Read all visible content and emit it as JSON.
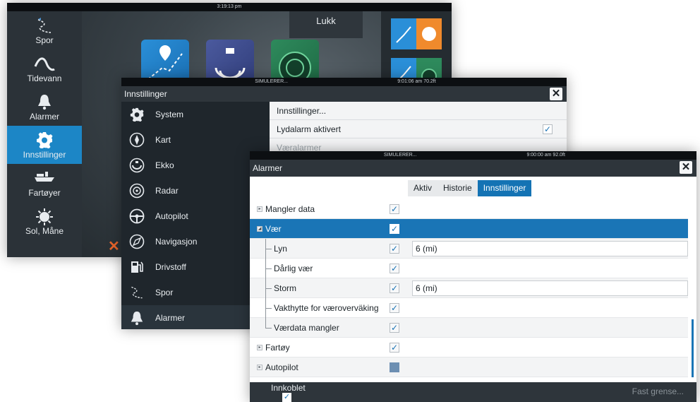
{
  "screen1": {
    "clock": "3:19:13 pm",
    "close_label": "Lukk",
    "sidebar": [
      {
        "label": "Spor",
        "icon": "track-icon"
      },
      {
        "label": "Tidevann",
        "icon": "tide-icon"
      },
      {
        "label": "Alarmer",
        "icon": "bell-icon"
      },
      {
        "label": "Innstillinger",
        "icon": "gear-icon",
        "active": true
      },
      {
        "label": "Fartøyer",
        "icon": "vessel-icon"
      },
      {
        "label": "Sol, Måne",
        "icon": "sun-moon-icon"
      }
    ]
  },
  "screen2": {
    "status_left": "SIMULERER...",
    "status_right": "9:01:06 am  70.2ft",
    "title": "Innstillinger",
    "menu": [
      {
        "label": "System",
        "icon": "gear-icon"
      },
      {
        "label": "Kart",
        "icon": "chart-icon"
      },
      {
        "label": "Ekko",
        "icon": "echo-icon"
      },
      {
        "label": "Radar",
        "icon": "radar-icon"
      },
      {
        "label": "Autopilot",
        "icon": "steering-wheel-icon"
      },
      {
        "label": "Navigasjon",
        "icon": "compass-icon"
      },
      {
        "label": "Drivstoff",
        "icon": "fuel-icon"
      },
      {
        "label": "Spor",
        "icon": "track-icon"
      },
      {
        "label": "Alarmer",
        "icon": "bell-icon",
        "active": true
      }
    ],
    "panel": [
      {
        "label": "Innstillinger..."
      },
      {
        "label": "Lydalarm aktivert",
        "checked": true
      },
      {
        "label": "Væralarmer"
      }
    ]
  },
  "screen3": {
    "status_left": "SIMULERER...",
    "status_right": "9:00:00 am  92.0ft",
    "title": "Alarmer",
    "tabs": [
      {
        "label": "Aktiv",
        "active": false
      },
      {
        "label": "Historie",
        "active": false
      },
      {
        "label": "Innstillinger",
        "active": true
      }
    ],
    "rows": [
      {
        "label": "Mangler data",
        "level": 0,
        "expander": "collapsed",
        "check": "checked"
      },
      {
        "label": "Vær",
        "level": 0,
        "expander": "expanded",
        "check": "checked",
        "selected": true
      },
      {
        "label": "Lyn",
        "level": 1,
        "check": "checked",
        "value": "6 (mi)"
      },
      {
        "label": "Dårlig vær",
        "level": 1,
        "check": "checked"
      },
      {
        "label": "Storm",
        "level": 1,
        "check": "checked",
        "value": "6 (mi)"
      },
      {
        "label": "Vakthytte for væroverväking",
        "level": 1,
        "check": "checked"
      },
      {
        "label": "Værdata mangler",
        "level": 1,
        "check": "checked"
      },
      {
        "label": "Fartøy",
        "level": 0,
        "expander": "collapsed",
        "check": "checked"
      },
      {
        "label": "Autopilot",
        "level": 0,
        "expander": "collapsed",
        "check": "partial"
      }
    ],
    "footer": {
      "enabled_label": "Innkoblet",
      "enabled": true,
      "limit_label": "Fast grense..."
    }
  },
  "colors": {
    "accent": "#1a75b6",
    "dark_bg": "#1e252b",
    "titlebar": "#2e353b"
  }
}
